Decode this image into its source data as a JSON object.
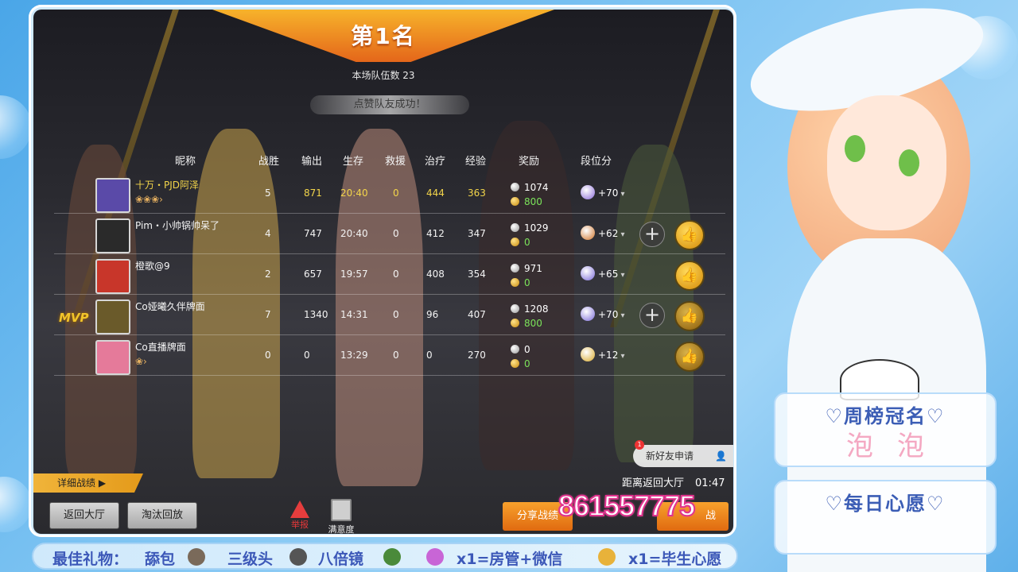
{
  "game": {
    "rank_title": "第1名",
    "team_count": "本场队伍数 23",
    "toast": "点赞队友成功！",
    "headers": [
      "昵称",
      "战胜",
      "输出",
      "生存",
      "救援",
      "治疗",
      "经验",
      "奖励",
      "段位分"
    ],
    "players": [
      {
        "name": "十万・PJD阿泽",
        "gold": true,
        "wins": "5",
        "output": "871",
        "survive": "20:40",
        "rescue": "0",
        "heal": "444",
        "exp": "363",
        "silver": "1074",
        "goldcoin": "800",
        "rank_pts": "+70",
        "add": false,
        "like": false,
        "mvp": false,
        "badges": "❀❀❀›",
        "hl": true
      },
      {
        "name": "Pim・小帅锅帅呆了",
        "gold": false,
        "wins": "4",
        "output": "747",
        "survive": "20:40",
        "rescue": "0",
        "heal": "412",
        "exp": "347",
        "silver": "1029",
        "goldcoin": "0",
        "rank_pts": "+62",
        "add": true,
        "like": true,
        "mvp": false,
        "badges": "",
        "hl": false
      },
      {
        "name": "橙歌@9",
        "gold": false,
        "wins": "2",
        "output": "657",
        "survive": "19:57",
        "rescue": "0",
        "heal": "408",
        "exp": "354",
        "silver": "971",
        "goldcoin": "0",
        "rank_pts": "+65",
        "add": false,
        "like": true,
        "mvp": false,
        "badges": "",
        "hl": false
      },
      {
        "name": "Co娅曦久伴牌面",
        "gold": false,
        "wins": "7",
        "output": "1340",
        "survive": "14:31",
        "rescue": "0",
        "heal": "96",
        "exp": "407",
        "silver": "1208",
        "goldcoin": "800",
        "rank_pts": "+70",
        "add": true,
        "like": true,
        "mvp": true,
        "badges": "",
        "hl": false
      },
      {
        "name": "Co直播牌面",
        "gold": false,
        "wins": "0",
        "output": "0",
        "survive": "13:29",
        "rescue": "0",
        "heal": "0",
        "exp": "270",
        "silver": "0",
        "goldcoin": "0",
        "rank_pts": "+12",
        "add": false,
        "like": true,
        "mvp": false,
        "badges": "❀›",
        "hl": false
      }
    ],
    "mvp_label": "MVP",
    "detail_tab": "详细战绩",
    "back_lobby_btn": "返回大厅",
    "elim_replay_btn": "淘汰回放",
    "report_label": "举报",
    "satisfaction_label": "满意度",
    "new_friend_label": "新好友申请",
    "new_friend_count": "1",
    "return_label": "距离返回大厅",
    "return_time": "01:47",
    "share_btn": "分享战绩",
    "continue_btn": "战"
  },
  "overlay": {
    "phone": "861557775",
    "weekly_title": "♡周榜冠名♡",
    "weekly_name": "泡泡",
    "daily_title": "♡每日心愿♡",
    "bottom": {
      "best_gift": "最佳礼物：",
      "gift1": "舔包",
      "gift2": "三级头",
      "gift3": "八倍镜",
      "perk1": "x1=房管+微信",
      "perk2": "x1=毕生心愿"
    }
  }
}
